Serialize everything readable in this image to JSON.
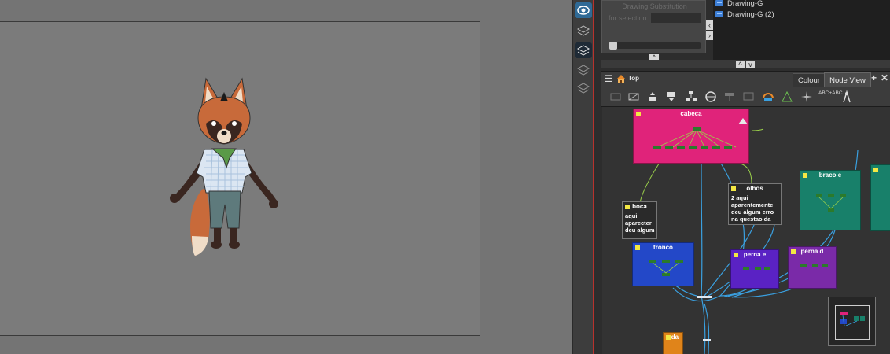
{
  "drawing_substitution": {
    "title": "Drawing Substitution",
    "selection_label": "for selection"
  },
  "layers": [
    {
      "name": "Drawing-G"
    },
    {
      "name": "Drawing-G (2)"
    }
  ],
  "node_view": {
    "breadcrumb": "Top",
    "tabs": [
      "Colour",
      "Node View"
    ],
    "add_symbol": "+",
    "close_symbol": "✕",
    "toolbar_text_icon": "ABC+ABC"
  },
  "nodes": [
    {
      "label": "cabeca",
      "color": "#e0237a"
    },
    {
      "label": "tronco",
      "color": "#2348c8"
    },
    {
      "label": "braco e",
      "color": "#18806a"
    },
    {
      "label": "perna e",
      "color": "#5a22c4"
    },
    {
      "label": "perna d",
      "color": "#7a2aa8"
    },
    {
      "label": "uda",
      "color": "#e0841a"
    }
  ],
  "notes": [
    {
      "label": "boca",
      "text": "aqui aparecter deu algum"
    },
    {
      "label": "olhos",
      "text": "2 aqui aparentemente deu algum erro na questao da"
    }
  ],
  "colors": {
    "accent_red": "#b8322d",
    "node_wire": "#3aa0e0",
    "note_square": "#f3e844"
  }
}
